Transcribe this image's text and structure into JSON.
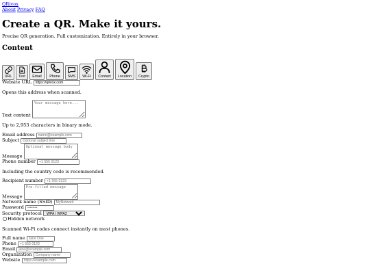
{
  "header": {
    "brand": "QRivox",
    "nav": [
      "About",
      "Privacy",
      "FAQ"
    ]
  },
  "hero": {
    "title": "Create a QR. Make it yours.",
    "tagline": "Precise QR generation. Full customization. Entirely in your browser."
  },
  "content": {
    "heading": "Content",
    "tabs": [
      {
        "label": "URL",
        "icon": "link-icon"
      },
      {
        "label": "Text",
        "icon": "document-icon"
      },
      {
        "label": "Email",
        "icon": "envelope-icon"
      },
      {
        "label": "Phone",
        "icon": "phone-icon"
      },
      {
        "label": "SMS",
        "icon": "chat-bubble-icon"
      },
      {
        "label": "Wi-Fi",
        "icon": "wifi-icon"
      },
      {
        "label": "Contact",
        "icon": "person-icon"
      },
      {
        "label": "Location",
        "icon": "map-pin-icon"
      },
      {
        "label": "Crypto",
        "icon": "bitcoin-icon"
      }
    ]
  },
  "url_form": {
    "label": "Website URL",
    "value": "https://qrivox.com",
    "help": "Opens this address when scanned."
  },
  "text_form": {
    "label": "Text content",
    "placeholder": "Your message here...",
    "help": "Up to 2,953 characters in binary mode."
  },
  "email_form": {
    "address_label": "Email address",
    "address_placeholder": "name@example.com",
    "subject_label": "Subject",
    "subject_placeholder": "Optional subject line",
    "message_label": "Message",
    "message_placeholder": "Optional message body"
  },
  "phone_form": {
    "label": "Phone number",
    "placeholder": "+1 555 0123",
    "help": "Including the country code is recommended."
  },
  "sms_form": {
    "recipient_label": "Recipient number",
    "recipient_placeholder": "+1 555 0123",
    "message_label": "Message",
    "message_placeholder": "Pre-filled message"
  },
  "wifi_form": {
    "ssid_label": "Network name (SSID)",
    "ssid_placeholder": "MyNetwork",
    "password_label": "Password",
    "password_placeholder": "••••••••",
    "security_label": "Security protocol",
    "security_selected": "WPA / WPA2",
    "hidden_label": "Hidden network",
    "hidden_checked": false,
    "help": "Scanned Wi-Fi codes connect instantly on most phones."
  },
  "contact_form": {
    "fullname_label": "Full name",
    "fullname_placeholder": "Jane Doe",
    "phone_label": "Phone",
    "phone_placeholder": "+1 555 0123",
    "email_label": "Email",
    "email_placeholder": "jane@example.com",
    "org_label": "Organization",
    "org_placeholder": "Company name",
    "website_label": "Website",
    "website_placeholder": "https://example.com"
  }
}
